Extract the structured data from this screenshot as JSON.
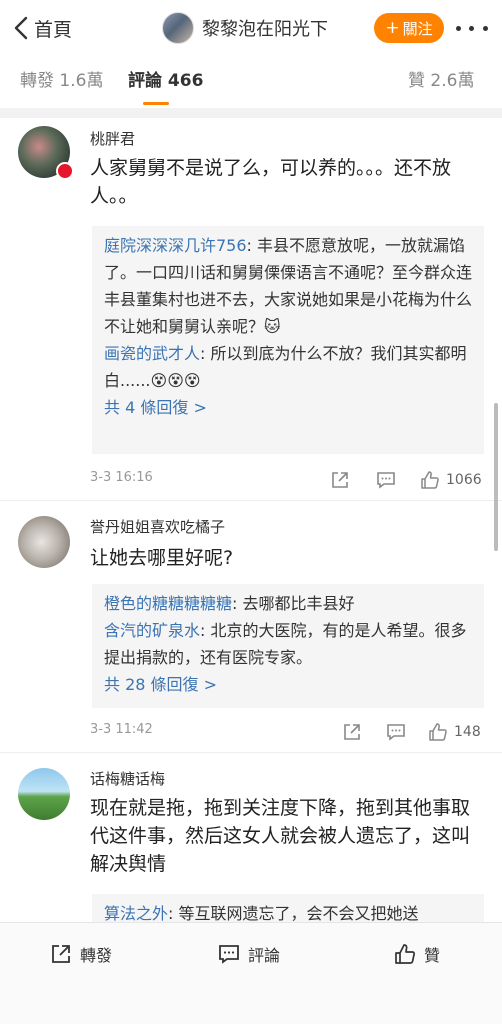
{
  "nav": {
    "back_label": "首頁",
    "title": "黎黎泡在阳光下",
    "follow_label": "關注",
    "follow_color": "#ff8200"
  },
  "tabs": {
    "reposts": "轉發 1.6萬",
    "comments": "評論 466",
    "likes": "贊 2.6萬"
  },
  "comments": [
    {
      "username": "桃胖君",
      "text": "人家舅舅不是说了么，可以养的。。。还不放人。。",
      "replies": [
        {
          "name": "庭院深深深几许756",
          "text": ": 丰县不愿意放呢，一放就漏馅了。一口四川话和舅舅傈傈语言不通呢？至今群众连丰县董集村也进不去，大家说她如果是小花梅为什么不让她和舅舅认亲呢？🐱"
        },
        {
          "name": "画瓷的武才人",
          "text": ": 所以到底为什么不放？我们其实都明白......😵😵😵"
        }
      ],
      "more": "共 4 條回復 >",
      "time": "3-3 16:16",
      "likes": "1066"
    },
    {
      "username": "誉丹姐姐喜欢吃橘子",
      "text": "让她去哪里好呢?",
      "replies": [
        {
          "name": "橙色的糖糖糖糖糖",
          "text": ": 去哪都比丰县好"
        },
        {
          "name": "含汽的矿泉水",
          "text": ": 北京的大医院，有的是人希望。很多提出捐款的，还有医院专家。"
        }
      ],
      "more": "共 28 條回復 >",
      "time": "3-3 11:42",
      "likes": "148"
    },
    {
      "username": "话梅糖话梅",
      "text": "现在就是拖，拖到关注度下降，拖到其他事取代这件事，然后这女人就会被人遗忘了，这叫解决舆情",
      "replies": [
        {
          "name": "算法之外",
          "text": ": 等互联网遗忘了，会不会又把她送"
        }
      ]
    }
  ],
  "bottom": {
    "repost": "轉發",
    "comment": "評論",
    "like": "贊"
  },
  "icons": {
    "back": "chevron-left-icon",
    "more": "more-dots-icon",
    "share": "share-icon",
    "comment": "comment-icon",
    "like": "thumbs-up-icon"
  }
}
